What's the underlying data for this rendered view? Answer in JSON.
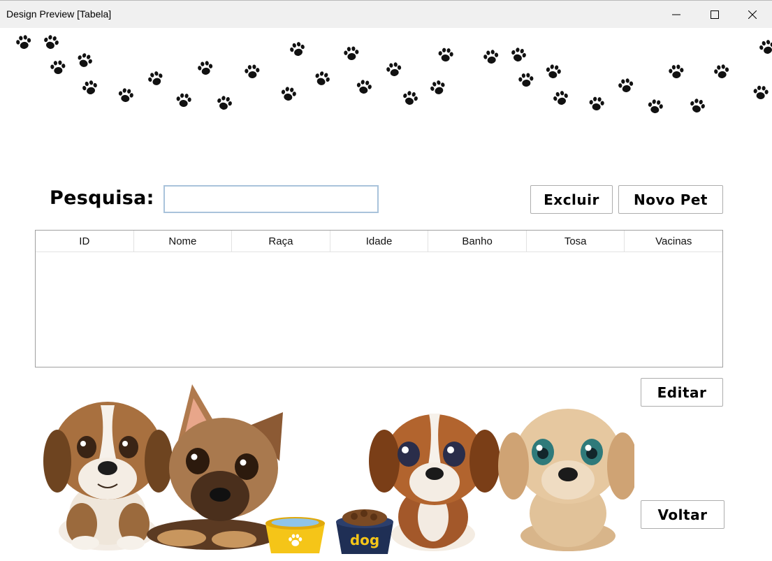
{
  "window": {
    "title": "Design Preview [Tabela]",
    "controls": [
      "minimize-icon",
      "maximize-icon",
      "close-icon"
    ]
  },
  "search": {
    "label": "Pesquisa:",
    "value": "",
    "placeholder": ""
  },
  "buttons": {
    "excluir": "Excluir",
    "novo_pet": "Novo Pet",
    "editar": "Editar",
    "voltar": "Voltar"
  },
  "table": {
    "columns": [
      "ID",
      "Nome",
      "Raça",
      "Idade",
      "Banho",
      "Tosa",
      "Vacinas"
    ],
    "rows": []
  },
  "decor": {
    "bowl_label": "dog",
    "header_icon": "paw-print-icon",
    "colors": {
      "paw": "#111111",
      "input_border": "#a9c3db",
      "bowl_yellow": "#f5c518",
      "bowl_navy": "#1f2f55"
    }
  }
}
